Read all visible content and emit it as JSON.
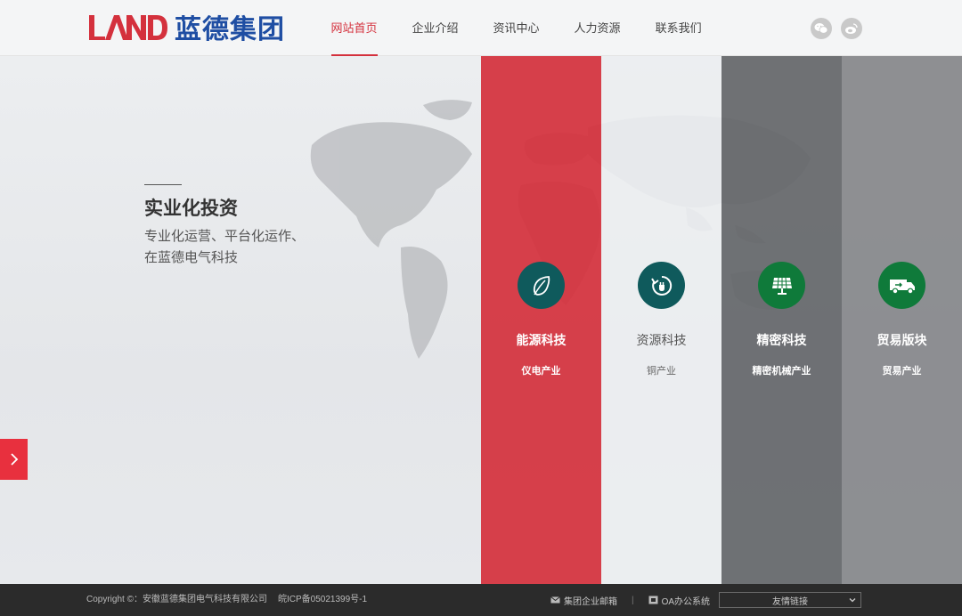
{
  "header": {
    "logo_text": "蓝德集团",
    "logo_mark": "LAND",
    "nav": [
      {
        "label": "网站首页",
        "active": true
      },
      {
        "label": "企业介绍",
        "active": false
      },
      {
        "label": "资讯中心",
        "active": false
      },
      {
        "label": "人力资源",
        "active": false
      },
      {
        "label": "联系我们",
        "active": false
      }
    ],
    "social": [
      {
        "icon": "wechat-icon"
      },
      {
        "icon": "weibo-icon"
      }
    ]
  },
  "hero": {
    "title": "实业化投资",
    "line1": "专业化运营、平台化运作、",
    "line2": "在蓝德电气科技"
  },
  "panels": [
    {
      "title": "能源科技",
      "subtitle": "仪电产业",
      "icon": "leaf-icon",
      "bg": "#d4313d",
      "circle": "#0f5a5c",
      "text_color": "#ffffff"
    },
    {
      "title": "资源科技",
      "subtitle": "铜产业",
      "icon": "recycle-plug-icon",
      "bg": "#eceef0",
      "circle": "#0f5a5c",
      "text_color": "#555555"
    },
    {
      "title": "精密科技",
      "subtitle": "精密机械产业",
      "icon": "solar-panel-icon",
      "bg": "#6b6d70",
      "circle": "#0f7a3a",
      "text_color": "#ffffff"
    },
    {
      "title": "贸易版块",
      "subtitle": "贸易产业",
      "icon": "truck-icon",
      "bg": "#8b8d90",
      "circle": "#0f7a3a",
      "text_color": "#ffffff"
    }
  ],
  "footer": {
    "copyright": "Copyright ©：安徽蓝德集团电气科技有限公司",
    "icp": "皖ICP备05021399号-1",
    "mail_label": "集团企业邮箱",
    "oa_label": "OA办公系统",
    "separator": "|",
    "friend_links": "友情链接"
  },
  "colors": {
    "accent": "#d4313d",
    "logo_blue": "#1f4ea3",
    "footer_bg": "#2b2b2b"
  }
}
